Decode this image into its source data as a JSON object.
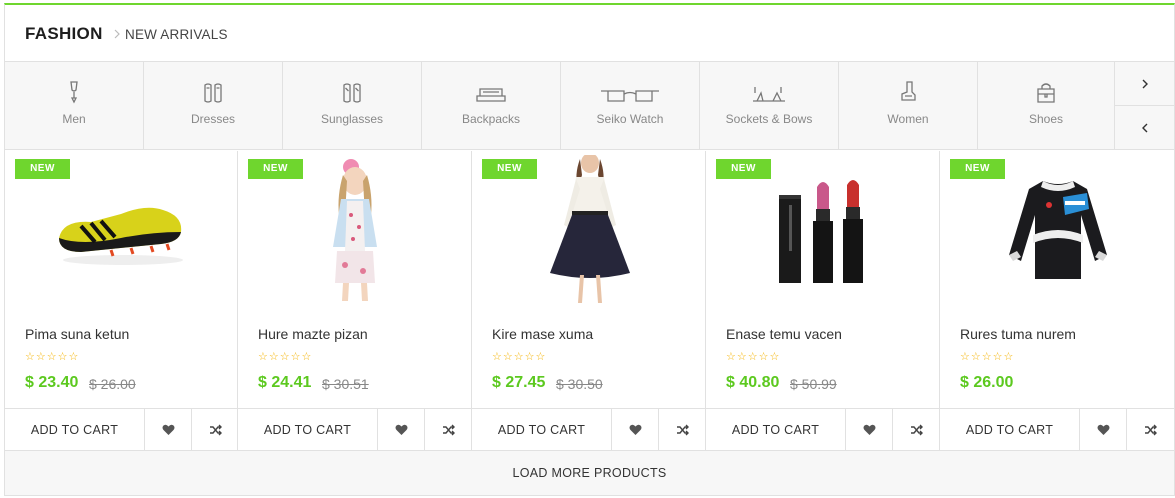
{
  "header": {
    "title": "FASHION",
    "breadcrumb": "NEW ARRIVALS"
  },
  "categories": [
    {
      "label": "Men",
      "icon": "men-icon"
    },
    {
      "label": "Dresses",
      "icon": "dress-icon"
    },
    {
      "label": "Sunglasses",
      "icon": "sunglasses-icon"
    },
    {
      "label": "Backpacks",
      "icon": "backpack-icon"
    },
    {
      "label": "Seiko Watch",
      "icon": "glasses-icon"
    },
    {
      "label": "Sockets & Bows",
      "icon": "bows-icon"
    },
    {
      "label": "Women",
      "icon": "women-icon"
    },
    {
      "label": "Shoes",
      "icon": "bag-icon"
    }
  ],
  "category_nav": {
    "next": "chevron-right-icon",
    "prev": "chevron-left-icon"
  },
  "products": [
    {
      "badge": "NEW",
      "name": "Pima suna ketun",
      "stars": "☆☆☆☆☆",
      "price": "$ 23.40",
      "old_price": "$ 26.00",
      "image": "soccer-shoe"
    },
    {
      "badge": "NEW",
      "name": "Hure mazte pizan",
      "stars": "☆☆☆☆☆",
      "price": "$ 24.41",
      "old_price": "$ 30.51",
      "image": "girl-outfit"
    },
    {
      "badge": "NEW",
      "name": "Kire mase xuma",
      "stars": "☆☆☆☆☆",
      "price": "$ 27.45",
      "old_price": "$ 30.50",
      "image": "dress"
    },
    {
      "badge": "NEW",
      "name": "Enase temu vacen",
      "stars": "☆☆☆☆☆",
      "price": "$ 40.80",
      "old_price": "$ 50.99",
      "image": "lipsticks"
    },
    {
      "badge": "NEW",
      "name": "Rures tuma nurem",
      "stars": "☆☆☆☆☆",
      "price": "$ 26.00",
      "old_price": "",
      "image": "cycling-jersey"
    }
  ],
  "actions": {
    "add_to_cart": "ADD TO CART",
    "wishlist_icon": "heart-icon",
    "compare_icon": "shuffle-icon"
  },
  "load_more": "LOAD MORE PRODUCTS",
  "colors": {
    "accent": "#6fd62e",
    "price": "#5cc91f",
    "star": "#f5b301",
    "border": "#e1e1e1"
  }
}
